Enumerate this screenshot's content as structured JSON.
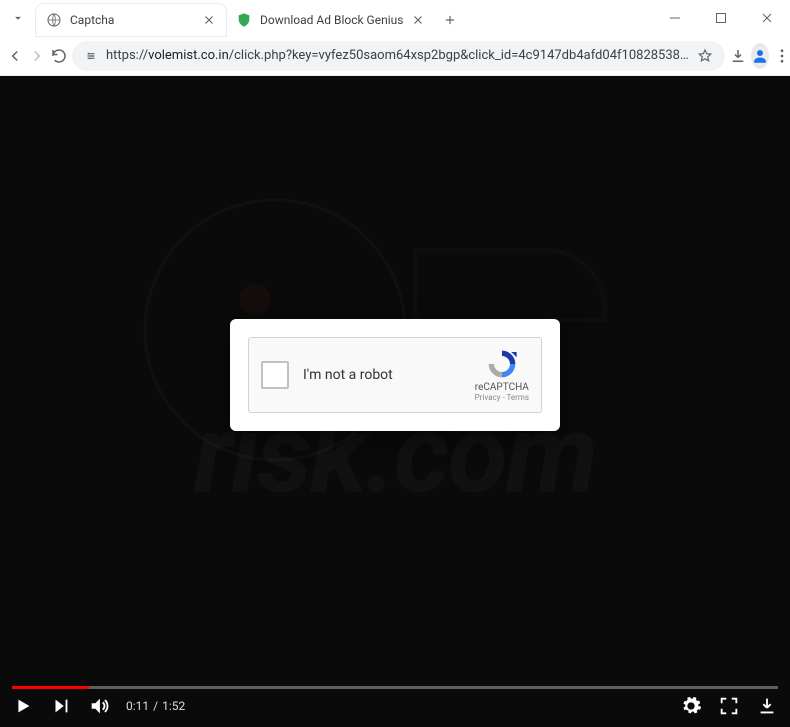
{
  "window": {
    "tabs": [
      {
        "title": "Captcha",
        "active": true
      },
      {
        "title": "Download Ad Block Genius",
        "active": false
      }
    ]
  },
  "address": {
    "scheme": "https://",
    "host": "volemist.co.in",
    "path": "/click.php?key=vyfez50saom64xsp2bgp&click_id=4c9147db4afd04f10828538…"
  },
  "captcha": {
    "label": "I'm not a robot",
    "brand": "reCAPTCHA",
    "privacy": "Privacy",
    "terms": "Terms",
    "sep": " - "
  },
  "video": {
    "elapsed": "0:11",
    "duration": "1:52",
    "sep": " / "
  },
  "watermark": {
    "text": "risk.com"
  }
}
